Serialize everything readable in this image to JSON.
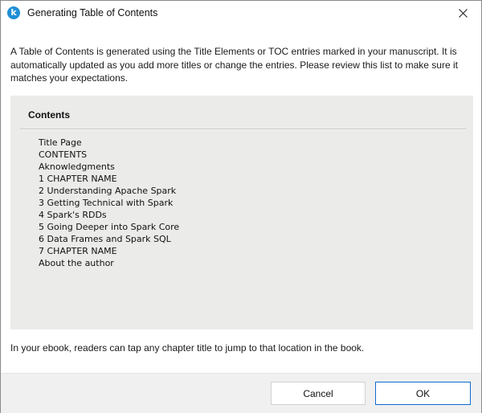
{
  "window": {
    "title": "Generating Table of Contents",
    "app_icon_glyph": "k",
    "app_icon_color": "#1f8fd6",
    "close_icon": "close-icon"
  },
  "description": "A Table of Contents is generated using the Title Elements or TOC entries marked in your manuscript. It is automatically updated as you add more titles or change the entries. Please review this list to make sure it matches your expectations.",
  "toc": {
    "heading": "Contents",
    "entries": [
      "Title Page",
      "CONTENTS",
      "Aknowledgments",
      "1 CHAPTER NAME",
      "2 Understanding Apache Spark",
      "3 Getting Technical with Spark",
      "4 Spark's RDDs",
      "5 Going Deeper into Spark Core",
      "6 Data Frames and Spark SQL",
      "7 CHAPTER NAME",
      "About the author"
    ]
  },
  "footer_note": "In your ebook, readers can tap any chapter title to jump to that location in the book.",
  "buttons": {
    "cancel_label": "Cancel",
    "ok_label": "OK",
    "ok_border_color": "#0f6bd0"
  }
}
